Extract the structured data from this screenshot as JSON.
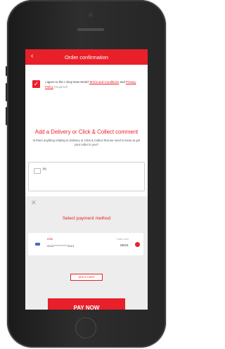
{
  "header": {
    "title": "Order confirmation",
    "back_icon": "chevron-left-icon"
  },
  "agree": {
    "checked": true,
    "text_before": "I agree to the I shop New World ",
    "terms_link": "Terms and Conditions",
    "text_and": " and ",
    "privacy_link": "Privacy Policy",
    "required": " (required)"
  },
  "comment": {
    "title": "Add a Delivery or Click & Collect comment",
    "subtitle": "Is there anything relating to Delivery or Click & Collect that we need to know to get your order to you?",
    "value": "Hi"
  },
  "payment": {
    "title": "Select payment method",
    "card": {
      "name": "new",
      "number": "4111**********1111",
      "valid_label": "Valid until",
      "valid_value": "05/24"
    },
    "add_card_label": "ADD A CARD",
    "pay_now_label": "PAY NOW"
  },
  "colors": {
    "accent": "#e8202a",
    "gray_bg": "#ededed"
  }
}
